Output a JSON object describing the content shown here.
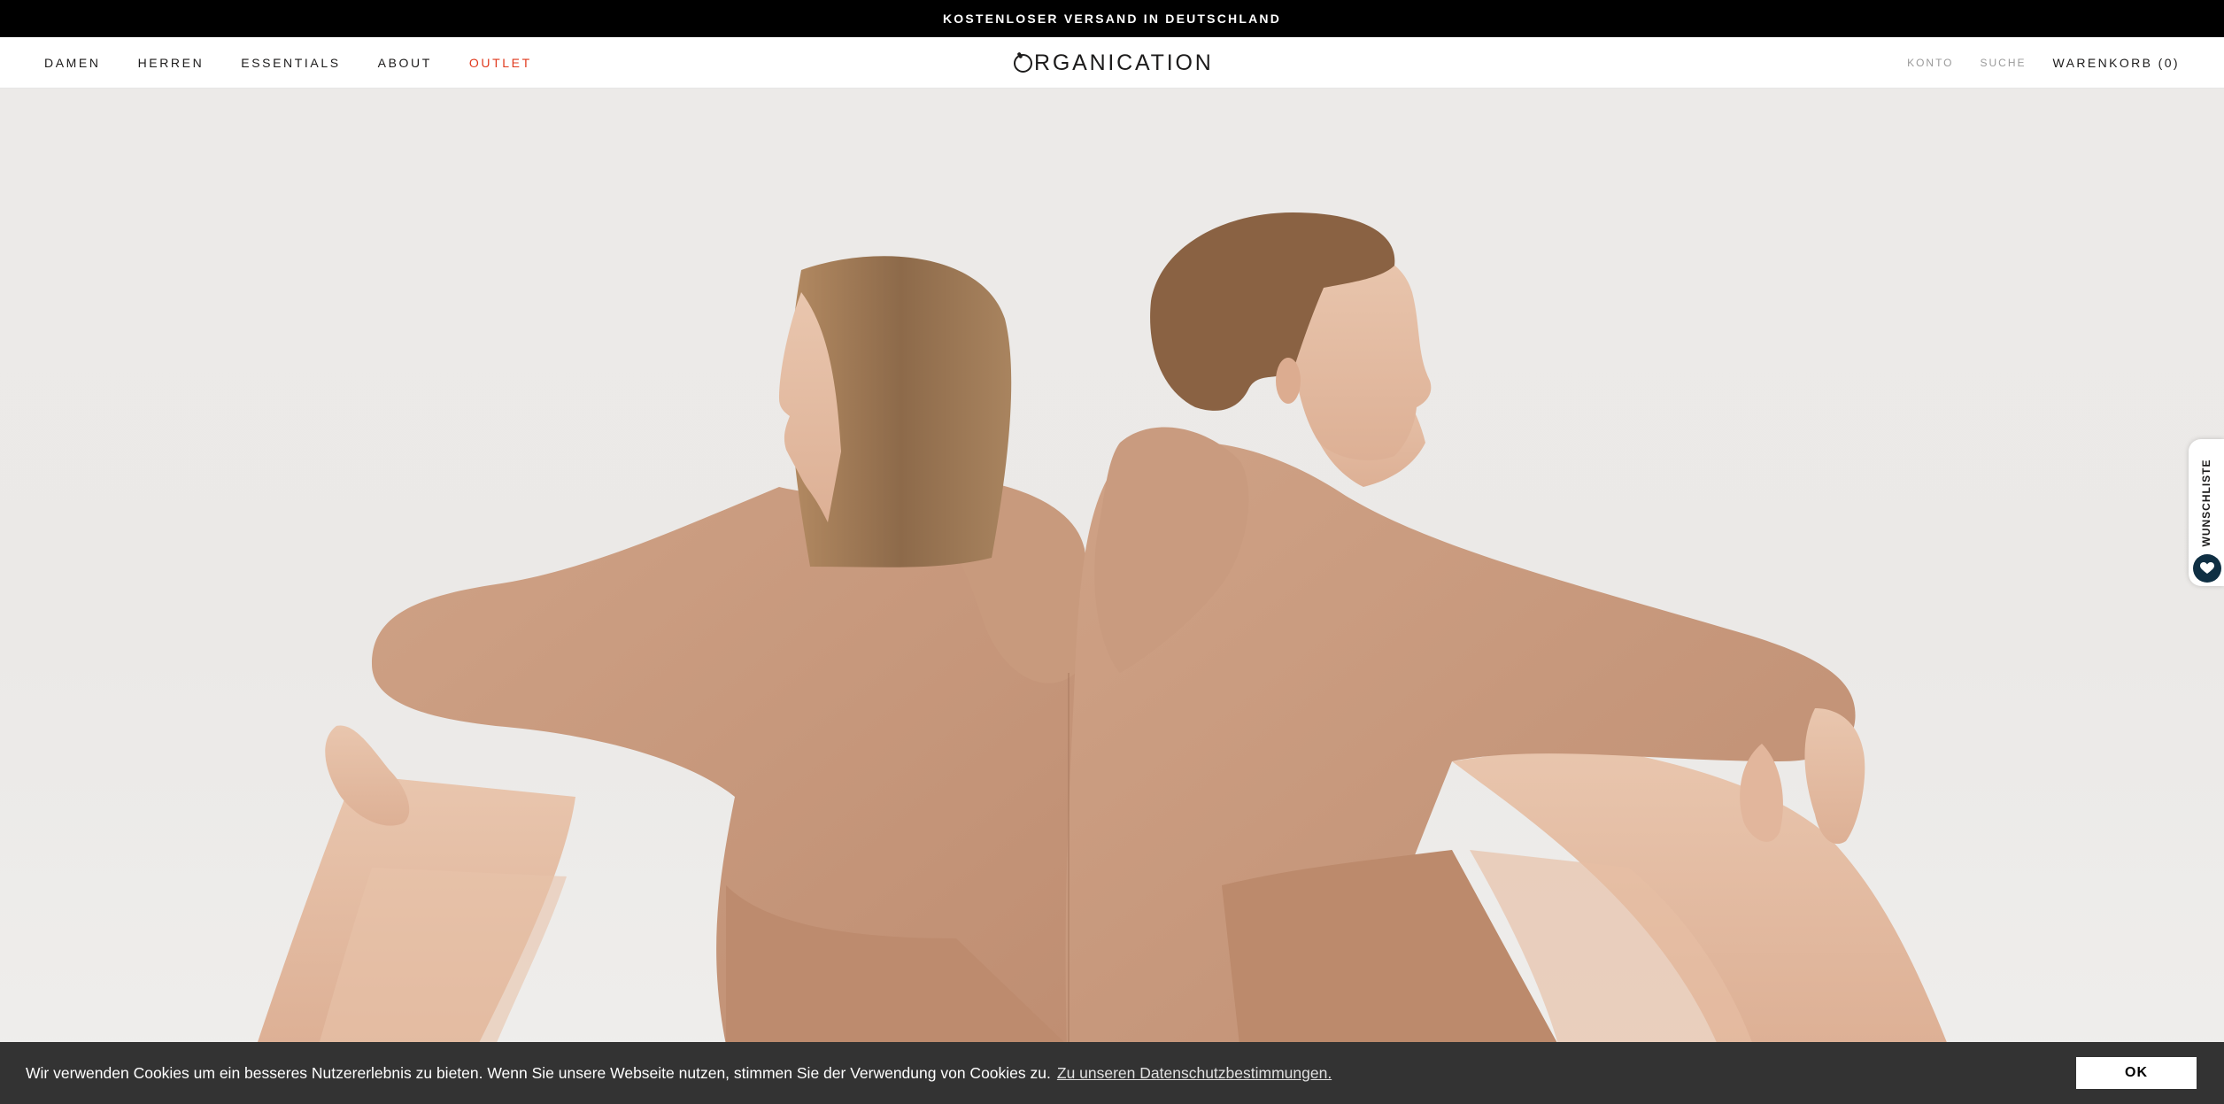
{
  "announcement": {
    "text": "KOSTENLOSER VERSAND IN DEUTSCHLAND"
  },
  "header": {
    "nav": [
      {
        "label": "DAMEN"
      },
      {
        "label": "HERREN"
      },
      {
        "label": "ESSENTIALS"
      },
      {
        "label": "ABOUT"
      },
      {
        "label": "OUTLET"
      }
    ],
    "logo_text": "RGANICATION",
    "account_label": "KONTO",
    "search_label": "SUCHE",
    "cart_label": "WARENKORB (0)"
  },
  "wishlist": {
    "label": "WUNSCHLISTE"
  },
  "cookie": {
    "text": "Wir verwenden Cookies um ein besseres Nutzererlebnis zu bieten. Wenn Sie unsere Webseite nutzen, stimmen Sie der Verwendung von Cookies zu.",
    "link_label": "Zu unseren Datenschutzbestimmungen.",
    "ok_label": "OK"
  },
  "colors": {
    "announcement_bg": "#000000",
    "sale_link": "#e03a1e",
    "hoodie": "#c99b7f",
    "cookie_bg": "#333333",
    "wishlist_heart_bg": "#0f2f43"
  }
}
